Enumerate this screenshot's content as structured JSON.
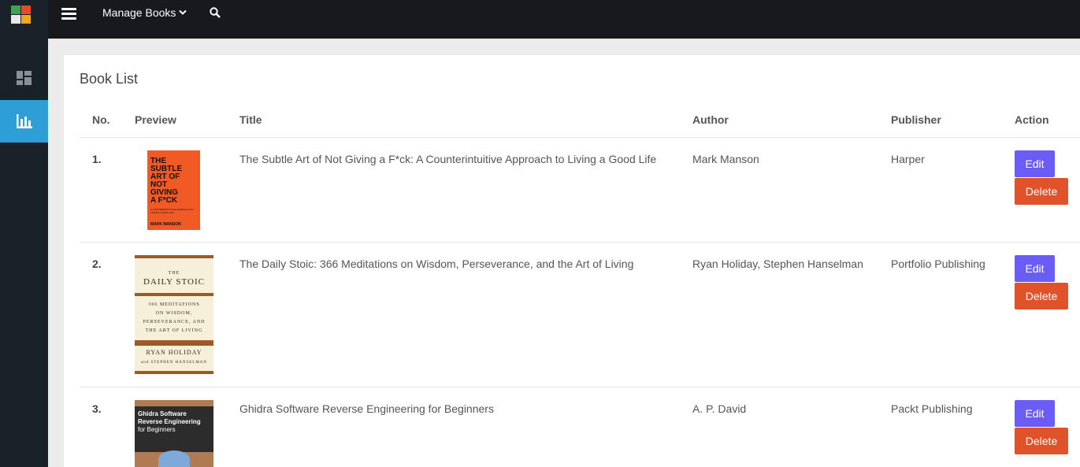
{
  "colors": {
    "sidebar": "#1b2129",
    "topbar": "#17191c",
    "active": "#2e9fd6",
    "edit": "#6b5cf6",
    "delete": "#e0532a"
  },
  "topbar": {
    "menu_label": "Manage Books"
  },
  "sidebar": {
    "items": [
      {
        "icon": "dashboard-icon"
      },
      {
        "icon": "bar-chart-icon",
        "active": true
      }
    ]
  },
  "page": {
    "title": "Book List"
  },
  "table": {
    "headers": {
      "no": "No.",
      "preview": "Preview",
      "title": "Title",
      "author": "Author",
      "publisher": "Publisher",
      "action": "Action"
    },
    "rows": [
      {
        "no": "1.",
        "title": "The Subtle Art of Not Giving a F*ck: A Counterintuitive Approach to Living a Good Life",
        "author": "Mark Manson",
        "publisher": "Harper",
        "edit": "Edit",
        "delete": "Delete",
        "cover": {
          "l1": "THE",
          "l2": "SUBTLE",
          "l3": "ART OF",
          "l4": "NOT",
          "l5": "GIVING",
          "l6": "A F*CK",
          "sub": "A COUNTERINTUITIVE APPROACH TO LIVING A GOOD LIFE",
          "author": "MARK MANSON"
        }
      },
      {
        "no": "2.",
        "title": "The Daily Stoic: 366 Meditations on Wisdom, Perseverance, and the Art of Living",
        "author": "Ryan Holiday, Stephen Hanselman",
        "publisher": "Portfolio Publishing",
        "edit": "Edit",
        "delete": "Delete",
        "cover": {
          "the": "THE",
          "name": "DAILY STOIC",
          "s1": "366 MEDITATIONS",
          "s2": "ON WISDOM,",
          "s3": "PERSEVERANCE, AND",
          "s4": "THE ART OF LIVING",
          "author": "RYAN HOLIDAY",
          "and": "and STEPHEN HANSELMAN"
        }
      },
      {
        "no": "3.",
        "title": "Ghidra Software Reverse Engineering for Beginners",
        "author": "A. P. David",
        "publisher": "Packt Publishing",
        "edit": "Edit",
        "delete": "Delete",
        "cover": {
          "t1": "Ghidra Software",
          "t2": "Reverse Engineering",
          "t3": "for Beginners"
        }
      }
    ]
  }
}
